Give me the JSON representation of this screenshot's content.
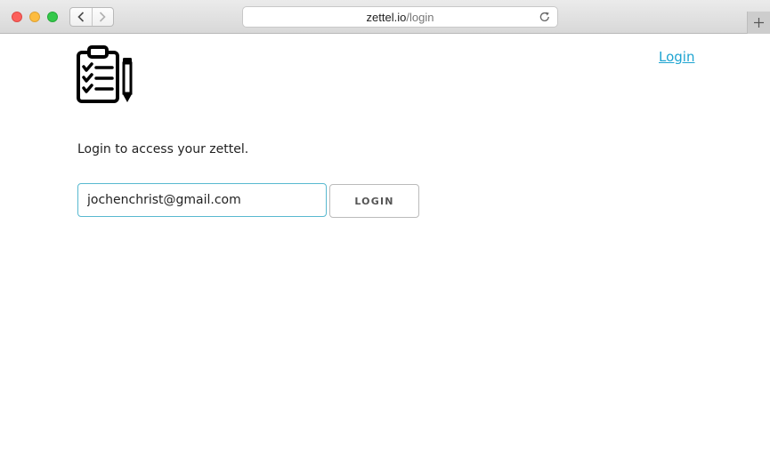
{
  "browser": {
    "url_host": "zettel.io",
    "url_path": "/login",
    "icons": {
      "close": "red-circle",
      "minimize": "yellow-circle",
      "zoom": "green-circle",
      "back": "chevron-left-icon",
      "forward": "chevron-right-icon",
      "reload": "reload-icon",
      "new_tab": "plus-icon"
    }
  },
  "header": {
    "logo_icon": "clipboard-checklist-pencil-icon",
    "login_link": "Login"
  },
  "main": {
    "intro_text": "Login to access your zettel.",
    "email_value": "jochenchrist@gmail.com",
    "login_button": "LOGIN"
  },
  "colors": {
    "link": "#1ea4d1",
    "input_focus_border": "#58b9d0",
    "button_border": "#bbbbbb"
  }
}
